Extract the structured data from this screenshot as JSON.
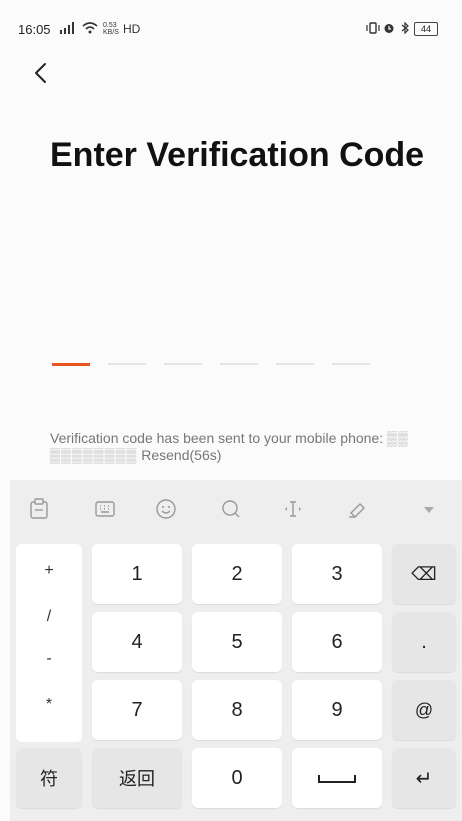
{
  "status_bar": {
    "time": "16:05",
    "signal": "4G",
    "net_speed": "0.53 KB/S",
    "network": "HD",
    "battery": "44"
  },
  "title": "Enter Verification Code",
  "code_length": 6,
  "message": {
    "prefix": "Verification code has been sent to your mobile phone:",
    "masked_phone": "▒▒ ▒▒▒▒▒▒▒▒",
    "resend": "Resend(56s)"
  },
  "keyboard": {
    "side_symbols": [
      "+",
      "/",
      "-",
      "*"
    ],
    "digit_rows": [
      [
        "1",
        "2",
        "3"
      ],
      [
        "4",
        "5",
        "6"
      ],
      [
        "7",
        "8",
        "9"
      ]
    ],
    "right_keys": [
      "⌫",
      ".",
      "@"
    ],
    "bottom": {
      "symbols": "符",
      "back": "返回",
      "zero": "0",
      "enter": "↵"
    }
  },
  "colors": {
    "accent": "#e8551f",
    "slot": "#e4e4e4",
    "keyboard_bg": "#eeeeee"
  },
  "toolbar_icons": [
    "clipboard-icon",
    "keyboard-layout-icon",
    "emoji-icon",
    "search-icon",
    "cursor-icon",
    "edit-icon",
    "collapse-icon"
  ]
}
